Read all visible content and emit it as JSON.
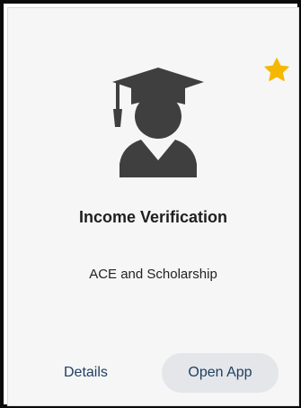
{
  "card": {
    "title": "Income Verification",
    "subtitle": "ACE and Scholarship",
    "icon": "graduate-icon",
    "favorite_icon": "star-icon",
    "favorite_color": "#f5b800",
    "icon_color": "#3f3f3f"
  },
  "actions": {
    "details_label": "Details",
    "open_label": "Open App"
  }
}
